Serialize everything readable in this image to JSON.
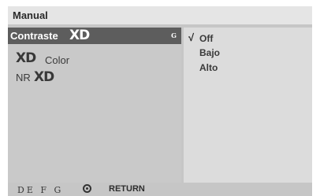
{
  "title": "Manual",
  "menu": {
    "items": [
      {
        "label": "Contraste",
        "logo": "XD",
        "arrow": "G"
      },
      {
        "logo": "XD",
        "label": "Color"
      },
      {
        "label": "NR",
        "logo": "XD"
      }
    ]
  },
  "options": {
    "check": "√",
    "items": [
      "Off",
      "Bajo",
      "Alto"
    ]
  },
  "footer": {
    "nav_glyphs": "DE F G",
    "enter_icon": "enter-icon",
    "return_label": "RETURN"
  }
}
